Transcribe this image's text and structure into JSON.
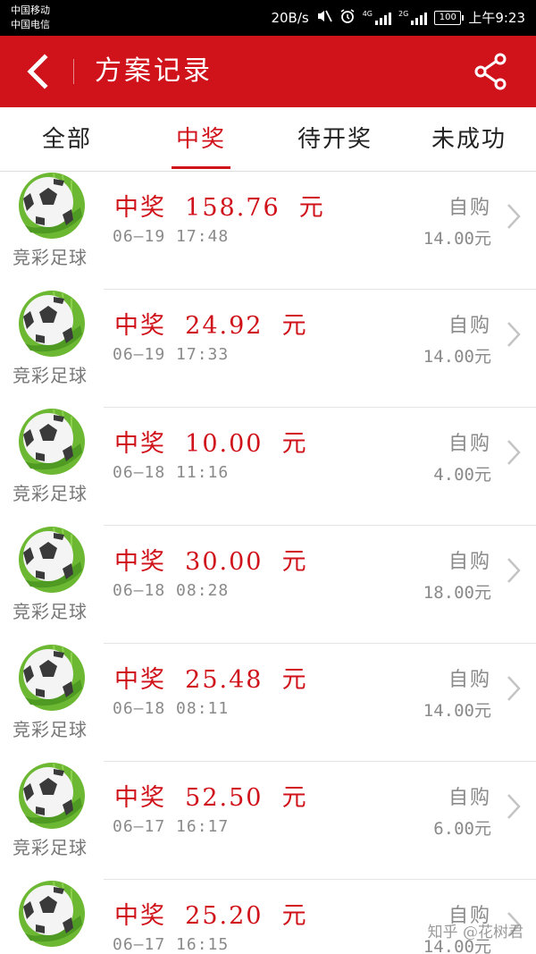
{
  "status_bar": {
    "carrier1": "中国移动",
    "carrier2": "中国电信",
    "speed": "20B/s",
    "net1": "4G",
    "net2": "2G",
    "battery": "100",
    "time": "上午9:23"
  },
  "header": {
    "title": "方案记录",
    "back_icon": "chevron-left-icon",
    "share_icon": "share-icon",
    "color": "#d0121b"
  },
  "tabs": [
    {
      "label": "全部",
      "active": false
    },
    {
      "label": "中奖",
      "active": true
    },
    {
      "label": "待开奖",
      "active": false
    },
    {
      "label": "未成功",
      "active": false
    }
  ],
  "records": [
    {
      "category": "竞彩足球",
      "prize": "中奖  158.76  元",
      "time": "06—19  17:48",
      "type": "自购",
      "cost": "14.00元"
    },
    {
      "category": "竞彩足球",
      "prize": "中奖  24.92  元",
      "time": "06—19  17:33",
      "type": "自购",
      "cost": "14.00元"
    },
    {
      "category": "竞彩足球",
      "prize": "中奖  10.00  元",
      "time": "06—18  11:16",
      "type": "自购",
      "cost": "4.00元"
    },
    {
      "category": "竞彩足球",
      "prize": "中奖  30.00  元",
      "time": "06—18  08:28",
      "type": "自购",
      "cost": "18.00元"
    },
    {
      "category": "竞彩足球",
      "prize": "中奖  25.48  元",
      "time": "06—18  08:11",
      "type": "自购",
      "cost": "14.00元"
    },
    {
      "category": "竞彩足球",
      "prize": "中奖  52.50  元",
      "time": "06—17  16:17",
      "type": "自购",
      "cost": "6.00元"
    },
    {
      "category": "竞彩足球",
      "prize": "中奖  25.20  元",
      "time": "06—17  16:15",
      "type": "自购",
      "cost": "14.00元"
    }
  ],
  "watermark": "知乎 @花树君"
}
